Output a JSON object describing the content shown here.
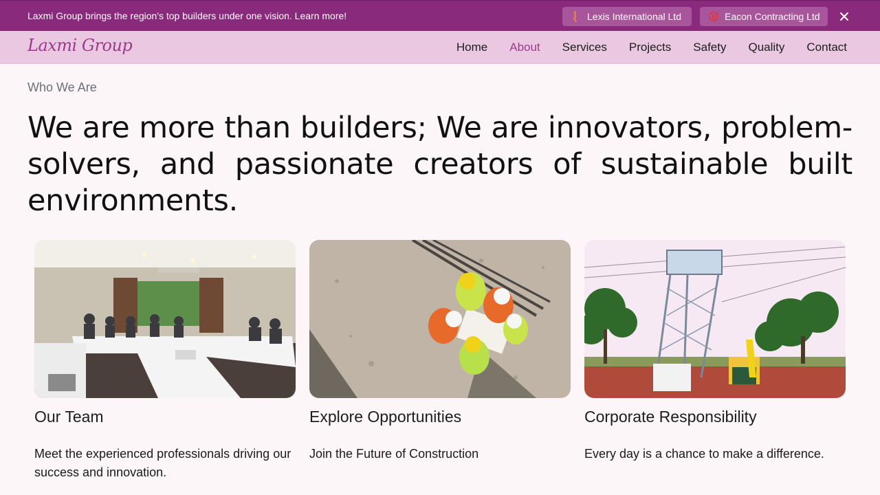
{
  "announcement": {
    "text": "Laxmi Group brings the region's top builders under one vision. Learn more!",
    "links": [
      {
        "label": "Lexis International Ltd",
        "icon": "lexis-logo-icon"
      },
      {
        "label": "Eacon Contracting Ltd",
        "icon": "eacon-logo-icon"
      }
    ],
    "close_icon": "close-icon"
  },
  "nav": {
    "logo": "Laxmi Group",
    "links": [
      "Home",
      "About",
      "Services",
      "Projects",
      "Safety",
      "Quality",
      "Contact"
    ],
    "active": "About"
  },
  "hero": {
    "eyebrow": "Who We Are",
    "headline": "We are more than builders; We are innovators, problem-solvers, and passionate creators of sustainable built environments."
  },
  "cards": [
    {
      "title": "Our Team",
      "text": "Meet the experienced professionals driving our success and innovation.",
      "image": "meeting-room-photo"
    },
    {
      "title": "Explore Opportunities",
      "text": "Join the Future of Construction",
      "image": "construction-workers-photo"
    },
    {
      "title": "Corporate Responsibility",
      "text": "Every day is a chance to make a difference.",
      "image": "water-tower-photo"
    }
  ],
  "colors": {
    "brand": "#8a2a7c",
    "nav_bg": "#ebc8e2",
    "page_bg": "#fcf6f8",
    "accent_text": "#9b3a8c"
  }
}
